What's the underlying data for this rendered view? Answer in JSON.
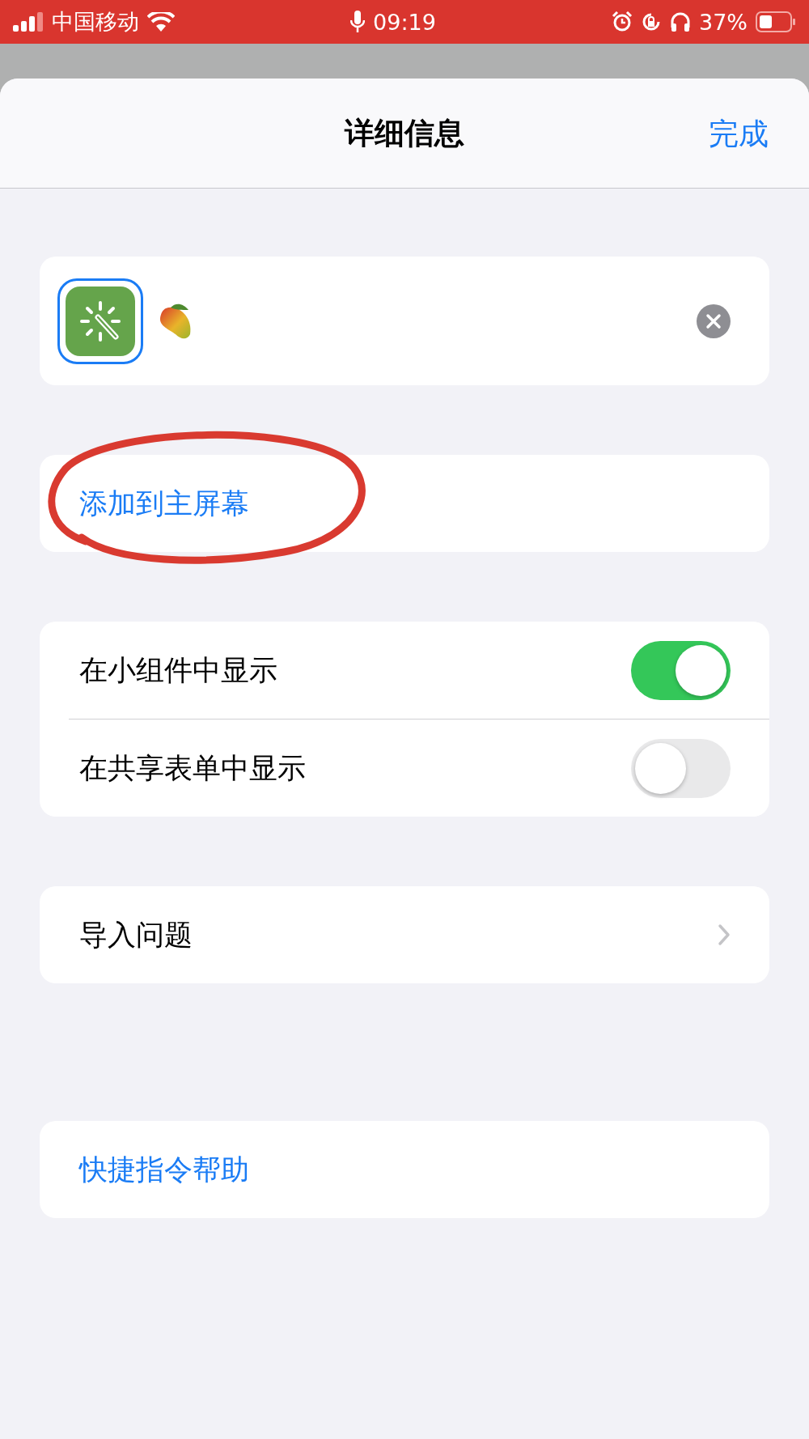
{
  "status_bar": {
    "carrier": "中国移动",
    "time": "09:19",
    "battery": "37%"
  },
  "sheet": {
    "title": "详细信息",
    "done": "完成"
  },
  "shortcut": {
    "icon_selected": true
  },
  "add_to_home": {
    "label": "添加到主屏幕",
    "circled": true
  },
  "toggles": [
    {
      "label": "在小组件中显示",
      "on": true
    },
    {
      "label": "在共享表单中显示",
      "on": false
    }
  ],
  "import_row": {
    "label": "导入问题"
  },
  "help": {
    "label": "快捷指令帮助"
  }
}
